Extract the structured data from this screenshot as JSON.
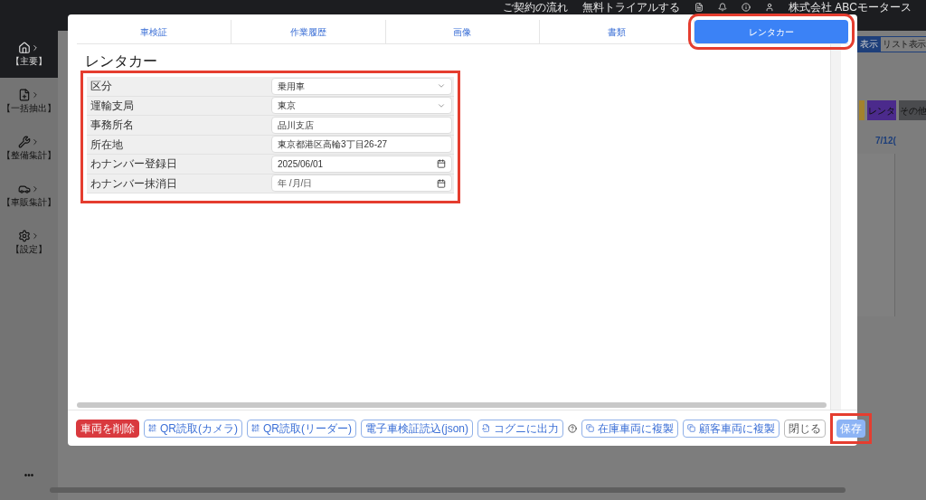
{
  "top_bar": {
    "links": [
      "ご契約の流れ",
      "無料トライアルする"
    ],
    "company": "株式会社 ABCモータース"
  },
  "sidebar": {
    "items": [
      {
        "kind": "home",
        "label": "【主要】",
        "selected": true
      },
      {
        "kind": "file",
        "label": "【一括抽出】",
        "selected": false
      },
      {
        "kind": "wrench",
        "label": "【整備集計】",
        "selected": false
      },
      {
        "kind": "car",
        "label": "【車販集計】",
        "selected": false
      },
      {
        "kind": "gear",
        "label": "【設定】",
        "selected": false
      }
    ],
    "more": "•••"
  },
  "background": {
    "view_buttons": [
      {
        "label": "表示",
        "selected": true
      },
      {
        "label": "リスト表示",
        "selected": false
      }
    ],
    "tags": [
      {
        "color": "#a3822d"
      },
      {
        "label": "レンタ",
        "color": "#4b2a8c"
      },
      {
        "label": "その他",
        "color": "#4a4b4e"
      }
    ],
    "date_headers": [
      "7/12("
    ]
  },
  "modal": {
    "tabs": [
      {
        "label": "車検証",
        "selected": false,
        "highlighted": false
      },
      {
        "label": "作業履歴",
        "selected": false,
        "highlighted": false
      },
      {
        "label": "画像",
        "selected": false,
        "highlighted": false
      },
      {
        "label": "書類",
        "selected": false,
        "highlighted": false
      },
      {
        "label": "レンタカー",
        "selected": true,
        "highlighted": true
      }
    ],
    "title": "レンタカー",
    "form": {
      "highlighted": true,
      "rows": [
        {
          "label": "区分",
          "kind": "select",
          "value": "乗用車"
        },
        {
          "label": "運輸支局",
          "kind": "select",
          "value": "東京"
        },
        {
          "label": "事務所名",
          "kind": "text",
          "value": "品川支店"
        },
        {
          "label": "所在地",
          "kind": "text",
          "value": "東京都港区高輪3丁目26-27"
        },
        {
          "label": "わナンバー登録日",
          "kind": "date",
          "value": "2025/06/01"
        },
        {
          "label": "わナンバー抹消日",
          "kind": "date",
          "placeholder": "年 /月/日"
        }
      ]
    },
    "footer": {
      "actions": [
        {
          "kind": "danger",
          "label": "車両を削除"
        },
        {
          "kind": "qr",
          "label": "QR読取(カメラ)"
        },
        {
          "kind": "qr",
          "label": "QR読取(リーダー)"
        },
        {
          "kind": "plain",
          "label": "電子車検証読込(json)"
        },
        {
          "kind": "export",
          "label": "コグニに出力",
          "help": true
        },
        {
          "kind": "copy",
          "label": "在庫車両に複製"
        },
        {
          "kind": "copy",
          "label": "顧客車両に複製"
        }
      ],
      "close": "閉じる",
      "save": {
        "label": "保存",
        "highlighted": true
      }
    }
  }
}
